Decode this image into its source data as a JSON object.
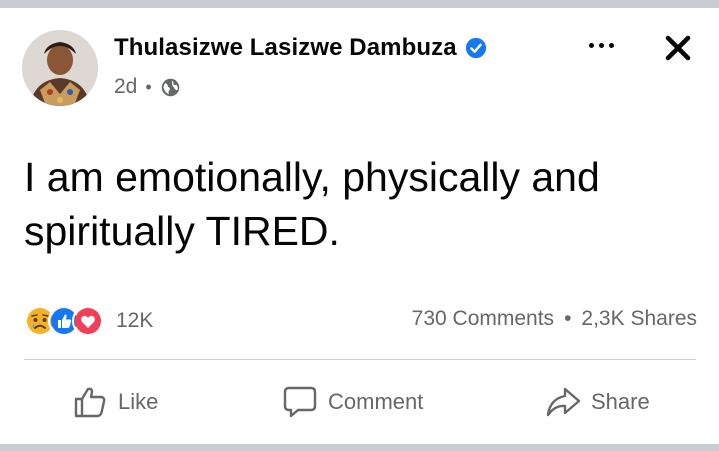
{
  "post": {
    "author": "Thulasizwe Lasizwe Dambuza",
    "time": "2d",
    "separator": "•",
    "text_line1": "I am emotionally, physically and",
    "text_line2": "spiritually TIRED."
  },
  "stats": {
    "reactions_count": "12K",
    "comments": "730 Comments",
    "separator": "•",
    "shares": "2,3K Shares"
  },
  "actions": {
    "like": "Like",
    "comment": "Comment",
    "share": "Share"
  },
  "icons": {
    "verified": "verified-badge-icon",
    "audience": "globe-icon",
    "more": "more-options-icon",
    "close": "close-icon",
    "reactions": [
      "sad-reaction-icon",
      "like-reaction-icon",
      "love-reaction-icon"
    ]
  },
  "colors": {
    "brand_blue": "#1877f2",
    "love_red": "#f33e58",
    "sad_yellow": "#f7b125",
    "secondary_text": "#65676b"
  }
}
